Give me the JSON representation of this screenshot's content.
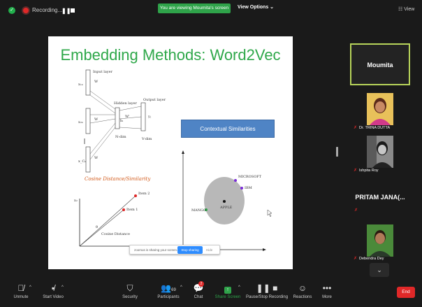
{
  "topbar": {
    "recording_label": "Recording...",
    "pause_icon": "pause-icon",
    "viewing_banner": "You are viewing Moumita's screen",
    "view_options": "View Options ⌄",
    "view_button": "View",
    "colors": {
      "viewing_banner": "#2fa34a",
      "record_dot": "#e02828"
    }
  },
  "slide": {
    "title": "Embedding Methods: Word2Vec",
    "diagram": {
      "input_layer": "Input layer",
      "hidden_layer": "Hidden layer",
      "output_layer": "Output layer",
      "w1": "W",
      "w2": "W",
      "w3": "W",
      "w_prime": "W'",
      "hi": "hᵢ",
      "yj": "yⱼ",
      "n_dim": "N-dim",
      "v_dim": "V-dim",
      "x1": "x₁ₖ",
      "x2": "x₂ₖ",
      "xc": "x_Cₖ"
    },
    "cosine_title": "Cosine Distance/Similarity",
    "cosine_chart": {
      "axis_y": "x₂",
      "item2": "Item 2",
      "item1": "Item 1",
      "theta": "θ",
      "cosine_label": "Cosine Distance"
    },
    "contextual_box": "Contextual Similarities",
    "circle_labels": {
      "microsoft": "MICROSOFT",
      "ibm": "IBM",
      "apple": "APPLE",
      "mango": "MANGO"
    },
    "sharing_bar": {
      "text": "zoomus is sharing your screen.",
      "stop": "Stop sharing",
      "hide": "Hide"
    }
  },
  "participants_panel": {
    "active": "Moumita",
    "thumbs": [
      {
        "name": "Dr. TRINA DUTTA",
        "muted": true
      },
      {
        "name": "Ishpita Roy",
        "muted": true
      },
      {
        "name": "Debendra Dey",
        "muted": true
      }
    ],
    "pritam": "PRITAM  JANA(...",
    "scroll_down": "⌄"
  },
  "toolbar": {
    "unmute": "Unmute",
    "start_video": "Start Video",
    "security": "Security",
    "participants": "Participants",
    "participants_count": "69",
    "chat": "Chat",
    "chat_badge": "2",
    "share_screen": "Share Screen",
    "record": "Pause/Stop Recording",
    "reactions": "Reactions",
    "more": "More",
    "end": "End",
    "colors": {
      "share": "#2fa34a",
      "end": "#e02828"
    }
  }
}
